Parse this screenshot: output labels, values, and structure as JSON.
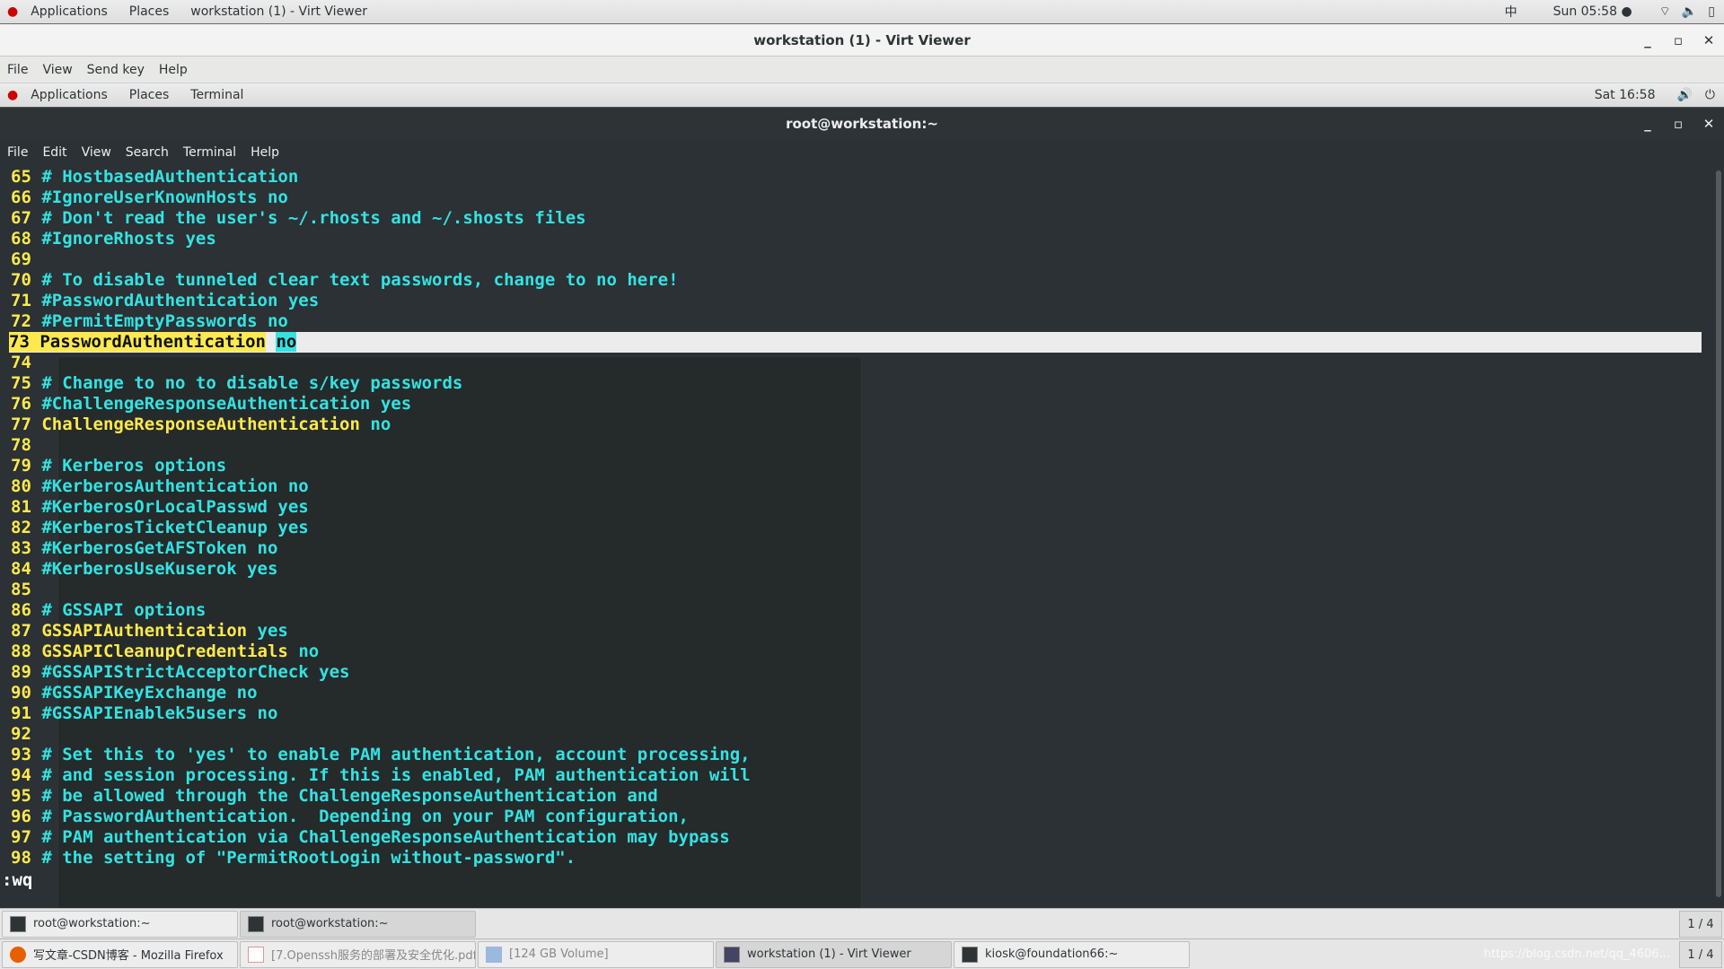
{
  "host_top": {
    "applications": "Applications",
    "places": "Places",
    "window": "workstation (1) - Virt Viewer",
    "input_method": "中",
    "clock": "Sun 05:58 ●"
  },
  "virt_viewer": {
    "title": "workstation (1) - Virt Viewer",
    "menu": [
      "File",
      "View",
      "Send key",
      "Help"
    ]
  },
  "guest_top": {
    "applications": "Applications",
    "places": "Places",
    "terminal": "Terminal",
    "clock": "Sat 16:58"
  },
  "terminal": {
    "title": "root@workstation:~",
    "menu": [
      "File",
      "Edit",
      "View",
      "Search",
      "Terminal",
      "Help"
    ],
    "lines": [
      [
        [
          "n",
          "65 "
        ],
        [
          "c",
          "# HostbasedAuthentication"
        ]
      ],
      [
        [
          "n",
          "66 "
        ],
        [
          "c",
          "#IgnoreUserKnownHosts no"
        ]
      ],
      [
        [
          "n",
          "67 "
        ],
        [
          "c",
          "# Don't read the user's ~/.rhosts and ~/.shosts files"
        ]
      ],
      [
        [
          "n",
          "68 "
        ],
        [
          "c",
          "#IgnoreRhosts yes"
        ]
      ],
      [
        [
          "n",
          "69 "
        ]
      ],
      [
        [
          "n",
          "70 "
        ],
        [
          "c",
          "# To disable tunneled clear text passwords, change to no here!"
        ]
      ],
      [
        [
          "n",
          "71 "
        ],
        [
          "c",
          "#PasswordAuthentication yes"
        ]
      ],
      [
        [
          "n",
          "72 "
        ],
        [
          "c",
          "#PermitEmptyPasswords no"
        ]
      ],
      [
        [
          "n",
          "73 "
        ],
        [
          "k",
          "PasswordAuthentication"
        ],
        [
          "x",
          " "
        ],
        [
          "v",
          "no"
        ]
      ],
      [
        [
          "n",
          "74 "
        ]
      ],
      [
        [
          "n",
          "75 "
        ],
        [
          "c",
          "# Change to no to disable s/key passwords"
        ]
      ],
      [
        [
          "n",
          "76 "
        ],
        [
          "c",
          "#ChallengeResponseAuthentication yes"
        ]
      ],
      [
        [
          "n",
          "77 "
        ],
        [
          "k",
          "ChallengeResponseAuthentication "
        ],
        [
          "v",
          "no"
        ]
      ],
      [
        [
          "n",
          "78 "
        ]
      ],
      [
        [
          "n",
          "79 "
        ],
        [
          "c",
          "# Kerberos options"
        ]
      ],
      [
        [
          "n",
          "80 "
        ],
        [
          "c",
          "#KerberosAuthentication no"
        ]
      ],
      [
        [
          "n",
          "81 "
        ],
        [
          "c",
          "#KerberosOrLocalPasswd yes"
        ]
      ],
      [
        [
          "n",
          "82 "
        ],
        [
          "c",
          "#KerberosTicketCleanup yes"
        ]
      ],
      [
        [
          "n",
          "83 "
        ],
        [
          "c",
          "#KerberosGetAFSToken no"
        ]
      ],
      [
        [
          "n",
          "84 "
        ],
        [
          "c",
          "#KerberosUseKuserok yes"
        ]
      ],
      [
        [
          "n",
          "85 "
        ]
      ],
      [
        [
          "n",
          "86 "
        ],
        [
          "c",
          "# GSSAPI options"
        ]
      ],
      [
        [
          "n",
          "87 "
        ],
        [
          "k",
          "GSSAPIAuthentication "
        ],
        [
          "v",
          "yes"
        ]
      ],
      [
        [
          "n",
          "88 "
        ],
        [
          "k",
          "GSSAPICleanupCredentials "
        ],
        [
          "v",
          "no"
        ]
      ],
      [
        [
          "n",
          "89 "
        ],
        [
          "c",
          "#GSSAPIStrictAcceptorCheck yes"
        ]
      ],
      [
        [
          "n",
          "90 "
        ],
        [
          "c",
          "#GSSAPIKeyExchange no"
        ]
      ],
      [
        [
          "n",
          "91 "
        ],
        [
          "c",
          "#GSSAPIEnablek5users no"
        ]
      ],
      [
        [
          "n",
          "92 "
        ]
      ],
      [
        [
          "n",
          "93 "
        ],
        [
          "c",
          "# Set this to 'yes' to enable PAM authentication, account processing,"
        ]
      ],
      [
        [
          "n",
          "94 "
        ],
        [
          "c",
          "# and session processing. If this is enabled, PAM authentication will"
        ]
      ],
      [
        [
          "n",
          "95 "
        ],
        [
          "c",
          "# be allowed through the ChallengeResponseAuthentication and"
        ]
      ],
      [
        [
          "n",
          "96 "
        ],
        [
          "c",
          "# PasswordAuthentication.  Depending on your PAM configuration,"
        ]
      ],
      [
        [
          "n",
          "97 "
        ],
        [
          "c",
          "# PAM authentication via ChallengeResponseAuthentication may bypass"
        ]
      ],
      [
        [
          "n",
          "98 "
        ],
        [
          "c",
          "# the setting of \"PermitRootLogin without-password\"."
        ]
      ]
    ],
    "highlight_line": "73",
    "command": ":wq"
  },
  "guest_taskbar": {
    "items": [
      "root@workstation:~",
      "root@workstation:~"
    ],
    "pager": "1 / 4"
  },
  "host_taskbar": {
    "items": [
      "写文章-CSDN博客 - Mozilla Firefox",
      "[7.Openssh服务的部署及安全优化.pdf]",
      "[124 GB Volume]",
      "workstation (1) - Virt Viewer",
      "kiosk@foundation66:~"
    ],
    "pager": "1 / 4",
    "watermark": "https://blog.csdn.net/qq_4606..."
  },
  "colors": {
    "yellow": "#fce94f",
    "cyan": "#34e2e2",
    "terminal_bg": "#2b3134"
  }
}
